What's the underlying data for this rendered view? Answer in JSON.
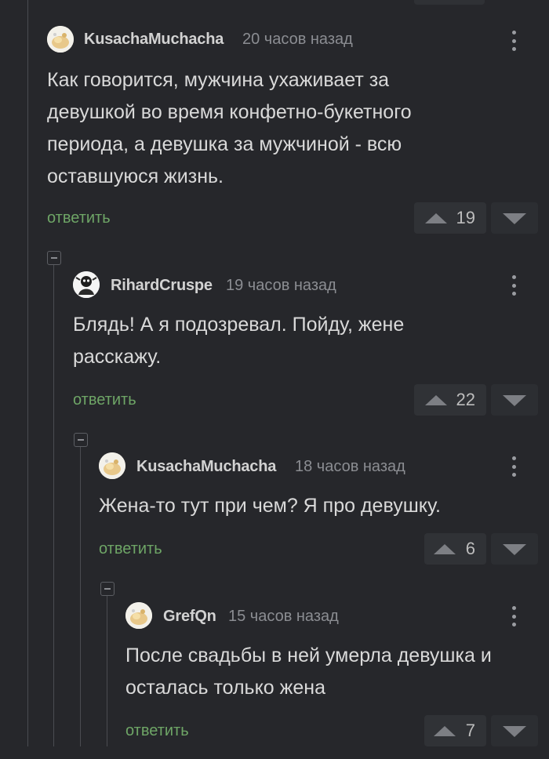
{
  "reply_label": "ответить",
  "comments": [
    {
      "author": "KusachaMuchacha",
      "time": "20 часов назад",
      "text_lines": [
        "Как говорится, мужчина ухаживает за",
        "девушкой во время конфетно-букетного",
        "периода, а девушка за мужчиной - всю",
        "оставшуюся жизнь."
      ],
      "rating": "19"
    },
    {
      "author": "RihardCruspe",
      "time": "19 часов назад",
      "text_lines": [
        "Блядь! А я подозревал. Пойду, жене",
        "расскажу."
      ],
      "rating": "22"
    },
    {
      "author": "KusachaMuchacha",
      "time": "18 часов назад",
      "text_lines": [
        "Жена-то тут при чем? Я про девушку."
      ],
      "rating": "6"
    },
    {
      "author": "GrefQn",
      "time": "15 часов назад",
      "text_lines": [
        "После свадьбы в ней умерла девушка и",
        "осталась только жена"
      ],
      "rating": "7"
    }
  ],
  "colors": {
    "background": "#26272b",
    "reply_link": "#6ea566",
    "author": "#d2d2d2",
    "meta": "#8b8d92",
    "rating_box": "#303236"
  },
  "icons": [
    "more-vertical-icon",
    "upvote-icon",
    "downvote-icon",
    "collapse-thread-icon",
    "avatar-icon"
  ]
}
